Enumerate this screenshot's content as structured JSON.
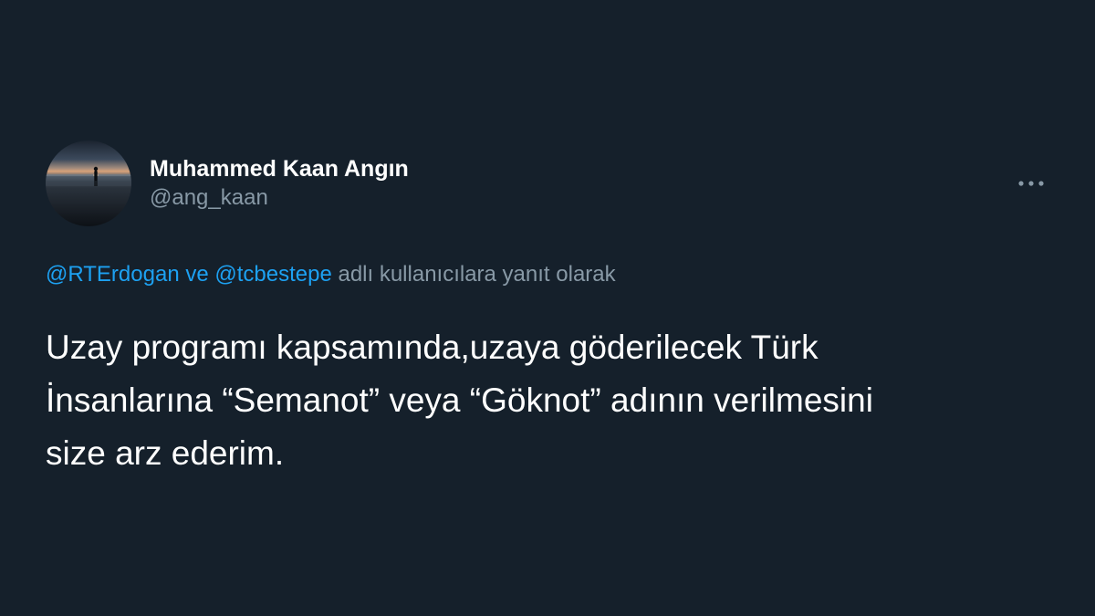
{
  "author": {
    "display_name": "Muhammed Kaan Angın",
    "handle": "@ang_kaan",
    "avatar_icon": "avatar-silhouette-sunset"
  },
  "menu": {
    "icon": "more-horizontal-icon"
  },
  "reply": {
    "mention_1": "@RTErdogan",
    "connector": " ve ",
    "mention_2": "@tcbestepe",
    "suffix": " adlı kullanıcılara yanıt olarak"
  },
  "tweet": {
    "line_1": "Uzay programı kapsamında,uzaya göderilecek Türk",
    "line_2": "İnsanlarına “Semanot” veya “Göknot” adının verilmesini",
    "line_3": "size arz ederim."
  },
  "colors": {
    "background": "#15202b",
    "primary_text": "#ffffff",
    "secondary_text": "#8899a6",
    "link": "#1da1f2"
  }
}
